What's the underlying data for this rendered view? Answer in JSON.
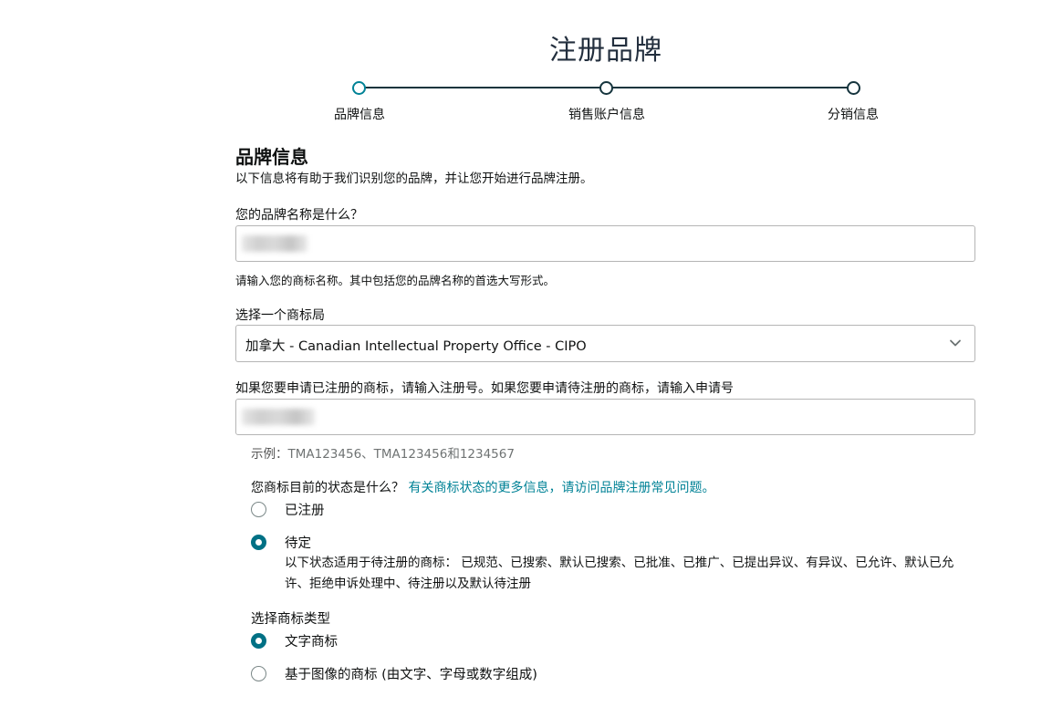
{
  "page": {
    "title": "注册品牌"
  },
  "stepper": {
    "steps": [
      {
        "label": "品牌信息"
      },
      {
        "label": "销售账户信息"
      },
      {
        "label": "分销信息"
      }
    ]
  },
  "section": {
    "title": "品牌信息",
    "description": "以下信息将有助于我们识别您的品牌，并让您开始进行品牌注册。"
  },
  "brand_name": {
    "label": "您的品牌名称是什么？",
    "value": "",
    "hint": "请输入您的商标名称。其中包括您的品牌名称的首选大写形式。"
  },
  "trademark_office": {
    "label": "选择一个商标局",
    "selected": "加拿大 - Canadian Intellectual Property Office - CIPO"
  },
  "registration_number": {
    "label": "如果您要申请已注册的商标，请输入注册号。如果您要申请待注册的商标，请输入申请号",
    "value": "",
    "example_prefix": "示例：",
    "example": "TMA123456、TMA123456和1234567"
  },
  "status": {
    "question": "您商标目前的状态是什么？",
    "link": "有关商标状态的更多信息，请访问品牌注册常见问题。",
    "options": [
      {
        "label": "已注册",
        "checked": false
      },
      {
        "label": "待定",
        "checked": true
      }
    ],
    "pending_description": "以下状态适用于待注册的商标： 已规范、已搜索、默认已搜索、已批准、已推广、已提出异议、有异议、已允许、默认已允许、拒绝申诉处理中、待注册以及默认待注册"
  },
  "mark_type": {
    "label": "选择商标类型",
    "options": [
      {
        "label": "文字商标",
        "checked": true
      },
      {
        "label": "基于图像的商标 (由文字、字母或数字组成)",
        "checked": false
      }
    ]
  },
  "colors": {
    "accent": "#008296",
    "radio_checked": "#007185",
    "stepper_line": "#15343d"
  }
}
